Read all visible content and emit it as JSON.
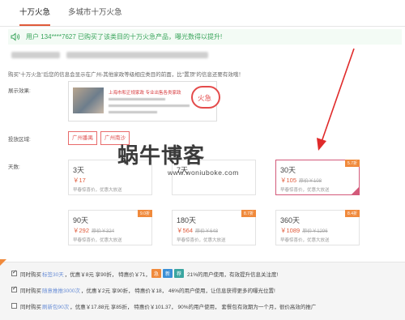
{
  "tabs": [
    {
      "label": "十万火急",
      "active": true
    },
    {
      "label": "多城市十万火急",
      "active": false
    }
  ],
  "notice": {
    "text": "用户 134****7627 已购买了该类目的十万火急产品，曝光数得以提升!",
    "icon": "speaker-icon",
    "color": "#3aa55c"
  },
  "description": "购买\"十万火急\"后您的信息会显示在广州-其他家政等级相应类目的前面，比\"置顶\"的信息还要有效哦！",
  "preview": {
    "label": "展示效果:",
    "title": "上海市和正规家政 专业出售各类家政",
    "badge": "火急"
  },
  "regions": {
    "label": "投放区域:",
    "items": [
      "广州番禺",
      "广州南沙"
    ]
  },
  "plans": {
    "label": "天数:",
    "items": [
      {
        "days": "3天",
        "price": "￥17",
        "original": "",
        "note": "早春惊喜价，优惠大放送",
        "discount": "",
        "selected": false
      },
      {
        "days": "7天",
        "price": "",
        "original": "",
        "note": "",
        "discount": "",
        "selected": false
      },
      {
        "days": "30天",
        "price": "￥105",
        "original": "原价￥108",
        "note": "早春惊喜价，优惠大放送",
        "discount": "5.7折",
        "selected": true
      },
      {
        "days": "90天",
        "price": "￥292",
        "original": "原价￥324",
        "note": "早春惊喜价，优惠大放送",
        "discount": "9.0折",
        "selected": false
      },
      {
        "days": "180天",
        "price": "￥564",
        "original": "原价￥648",
        "note": "早春惊喜价，优惠大放送",
        "discount": "8.7折",
        "selected": false
      },
      {
        "days": "360天",
        "price": "￥1089",
        "original": "原价￥1296",
        "note": "早春惊喜价，优惠大放送",
        "discount": "8.4折",
        "selected": false
      }
    ]
  },
  "watermark": {
    "title": "蜗牛博客",
    "url": "www.woniuboke.com"
  },
  "options": [
    {
      "checked": true,
      "pre": "同时购买",
      "highlight": "标签30天",
      "post": "，优惠￥8元 享90折， 特惠价￥71，",
      "pills": [
        {
          "text": "急",
          "color": "#f08a3c"
        },
        {
          "text": "新",
          "color": "#3a8fd6"
        },
        {
          "text": "荐",
          "color": "#3aa5a0"
        }
      ],
      "tail": "21%的用户使用，有效提升信息关注度!"
    },
    {
      "checked": true,
      "pre": "同时购买",
      "highlight": "随意推推3000次",
      "post": "，优惠￥2元 享90折， 特惠价￥18， 46%的用户使用，让信息获得更多的曝光位置!",
      "pills": [],
      "tail": ""
    },
    {
      "checked": false,
      "pre": "同时购买",
      "highlight": "刷新包90次",
      "post": "，优惠￥17.88元 享85折， 特惠价￥101.37， 90%的用户使用， 套餐包有效期为一个月，很价高效的推广",
      "pills": [],
      "tail": ""
    }
  ]
}
